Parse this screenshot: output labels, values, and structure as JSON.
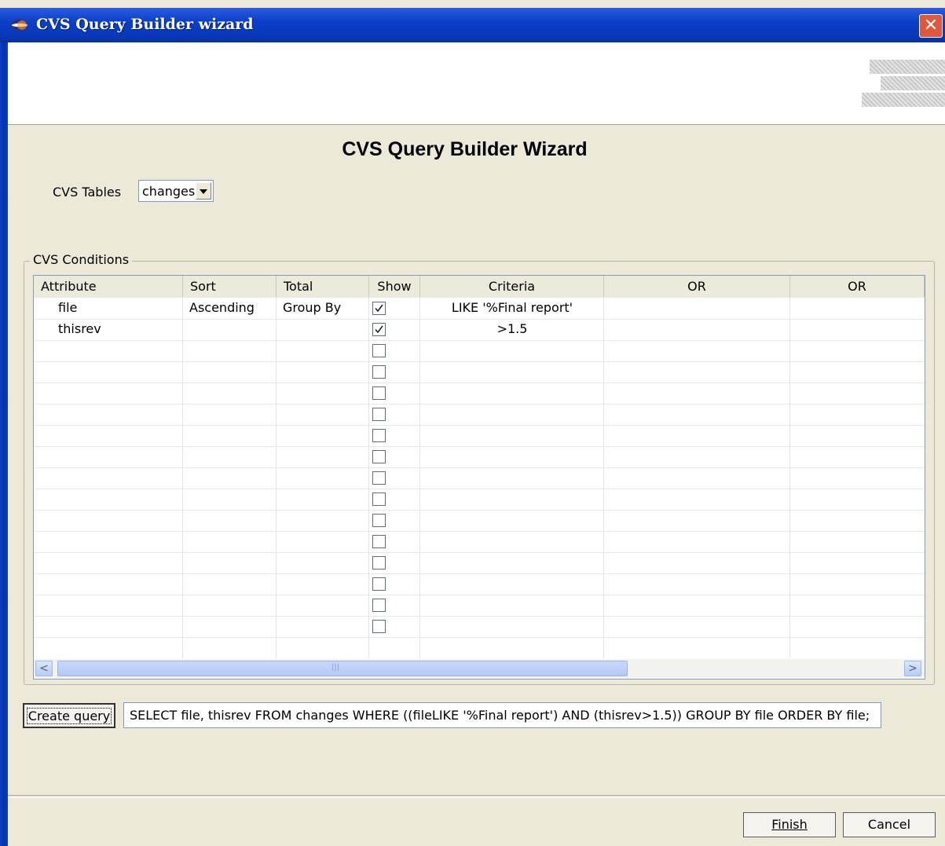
{
  "window": {
    "title": "CVS Query Builder wizard",
    "close_glyph": "✕"
  },
  "wizard": {
    "heading": "CVS Query Builder Wizard"
  },
  "tables": {
    "label": "CVS Tables",
    "selected": "changes"
  },
  "conditions": {
    "group_label": "CVS Conditions",
    "columns": [
      "Attribute",
      "Sort",
      "Total",
      "Show",
      "Criteria",
      "OR",
      "OR"
    ],
    "rows": [
      {
        "attribute": "file",
        "sort": "Ascending",
        "total": "Group By",
        "show": true,
        "criteria": "LIKE '%Final report'"
      },
      {
        "attribute": "thisrev",
        "sort": "",
        "total": "",
        "show": true,
        "criteria": ">1.5"
      },
      {
        "attribute": "",
        "sort": "",
        "total": "",
        "show": false,
        "criteria": ""
      },
      {
        "attribute": "",
        "sort": "",
        "total": "",
        "show": false,
        "criteria": ""
      },
      {
        "attribute": "",
        "sort": "",
        "total": "",
        "show": false,
        "criteria": ""
      },
      {
        "attribute": "",
        "sort": "",
        "total": "",
        "show": false,
        "criteria": ""
      },
      {
        "attribute": "",
        "sort": "",
        "total": "",
        "show": false,
        "criteria": ""
      },
      {
        "attribute": "",
        "sort": "",
        "total": "",
        "show": false,
        "criteria": ""
      },
      {
        "attribute": "",
        "sort": "",
        "total": "",
        "show": false,
        "criteria": ""
      },
      {
        "attribute": "",
        "sort": "",
        "total": "",
        "show": false,
        "criteria": ""
      },
      {
        "attribute": "",
        "sort": "",
        "total": "",
        "show": false,
        "criteria": ""
      },
      {
        "attribute": "",
        "sort": "",
        "total": "",
        "show": false,
        "criteria": ""
      },
      {
        "attribute": "",
        "sort": "",
        "total": "",
        "show": false,
        "criteria": ""
      },
      {
        "attribute": "",
        "sort": "",
        "total": "",
        "show": false,
        "criteria": ""
      },
      {
        "attribute": "",
        "sort": "",
        "total": "",
        "show": false,
        "criteria": ""
      },
      {
        "attribute": "",
        "sort": "",
        "total": "",
        "show": false,
        "criteria": ""
      }
    ],
    "scroll_left_glyph": "<",
    "scroll_right_glyph": ">",
    "thumb_grip": "|||"
  },
  "query": {
    "button_label": "Create query",
    "sql": "SELECT file, thisrev FROM changes WHERE ((fileLIKE '%Final report') AND (thisrev>1.5)) GROUP BY file ORDER BY file;"
  },
  "footer": {
    "finish_label": "Finish",
    "cancel_label": "Cancel"
  },
  "colors": {
    "titlebar": "#0a3fc8",
    "dialog_bg": "#ece9d8",
    "close_button": "#e2573c"
  },
  "icons": [
    "eclipse-app-icon",
    "close-icon",
    "chevron-down-icon",
    "check-icon",
    "scroll-left-icon",
    "scroll-right-icon"
  ]
}
